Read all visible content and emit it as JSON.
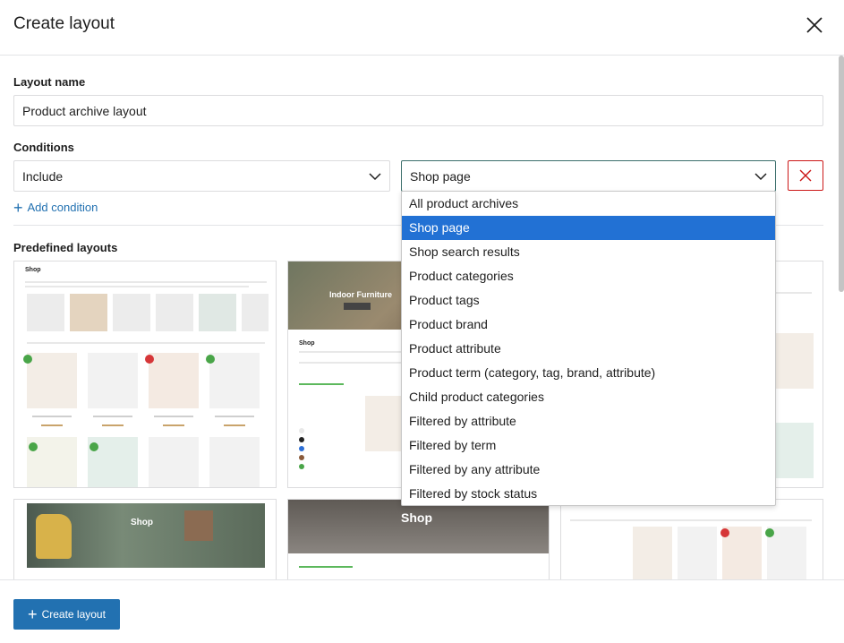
{
  "dialog": {
    "title": "Create layout"
  },
  "layout_name": {
    "label": "Layout name",
    "value": "Product archive layout"
  },
  "conditions": {
    "label": "Conditions",
    "type_value": "Include",
    "target_value": "Shop page",
    "add_condition_label": "Add condition"
  },
  "predefined": {
    "label": "Predefined layouts",
    "thumbs": {
      "t1_title": "Shop",
      "t2_hero": "Indoor Furniture",
      "t2_title": "Shop",
      "t4_hero": "Shop",
      "t5_hero": "Shop"
    }
  },
  "dropdown": {
    "options": [
      "All product archives",
      "Shop page",
      "Shop search results",
      "Product categories",
      "Product tags",
      "Product brand",
      "Product attribute",
      "Product term (category, tag, brand, attribute)",
      "Child product categories",
      "Filtered by attribute",
      "Filtered by term",
      "Filtered by any attribute",
      "Filtered by stock status"
    ],
    "selected": "Shop page"
  },
  "footer": {
    "create_label": "Create layout"
  },
  "colors": {
    "primary": "#2271b1",
    "selected": "#2271d4",
    "danger": "#cc1818"
  }
}
